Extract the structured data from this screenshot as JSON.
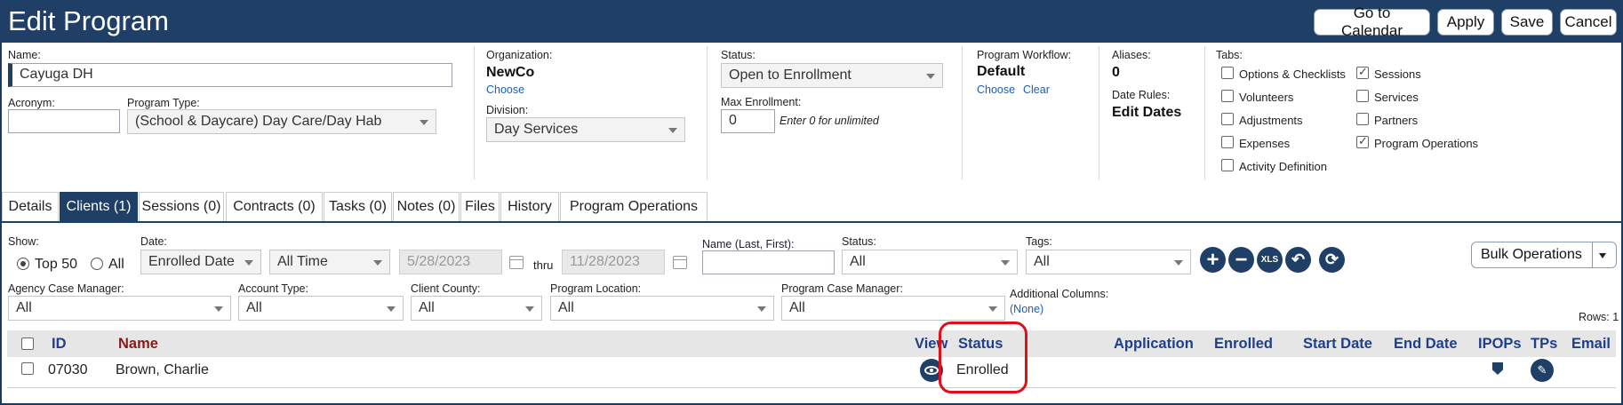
{
  "header": {
    "title": "Edit Program",
    "buttons": {
      "calendar": "Go to Calendar",
      "apply": "Apply",
      "save": "Save",
      "cancel": "Cancel"
    }
  },
  "form": {
    "name_label": "Name:",
    "name_value": "Cayuga DH",
    "acronym_label": "Acronym:",
    "acronym_value": "",
    "program_type_label": "Program Type:",
    "program_type_value": "(School & Daycare) Day Care/Day Hab",
    "organization_label": "Organization:",
    "organization_value": "NewCo",
    "organization_choose": "Choose",
    "division_label": "Division:",
    "division_value": "Day Services",
    "status_label": "Status:",
    "status_value": "Open to Enrollment",
    "max_enrollment_label": "Max Enrollment:",
    "max_enrollment_value": "0",
    "max_enrollment_hint": "Enter 0 for unlimited",
    "workflow_label": "Program Workflow:",
    "workflow_value": "Default",
    "workflow_choose": "Choose",
    "workflow_clear": "Clear",
    "aliases_label": "Aliases:",
    "aliases_value": "0",
    "date_rules_label": "Date Rules:",
    "date_rules_value": "Edit Dates",
    "tabs_label": "Tabs:",
    "tab_options": [
      {
        "label": "Options & Checklists",
        "checked": false
      },
      {
        "label": "Volunteers",
        "checked": false
      },
      {
        "label": "Adjustments",
        "checked": false
      },
      {
        "label": "Expenses",
        "checked": false
      },
      {
        "label": "Activity Definition",
        "checked": false
      },
      {
        "label": "Sessions",
        "checked": true
      },
      {
        "label": "Services",
        "checked": false
      },
      {
        "label": "Partners",
        "checked": false
      },
      {
        "label": "Program Operations",
        "checked": true
      }
    ]
  },
  "tabs": [
    {
      "label": "Details",
      "active": false
    },
    {
      "label": "Clients (1)",
      "active": true
    },
    {
      "label": "Sessions (0)",
      "active": false
    },
    {
      "label": "Contracts (0)",
      "active": false
    },
    {
      "label": "Tasks (0)",
      "active": false
    },
    {
      "label": "Notes (0)",
      "active": false
    },
    {
      "label": "Files",
      "active": false
    },
    {
      "label": "History",
      "active": false
    },
    {
      "label": "Program Operations",
      "active": false
    }
  ],
  "filters": {
    "show_label": "Show:",
    "top50": "Top 50",
    "all": "All",
    "date_label": "Date:",
    "date_field": "Enrolled Date",
    "date_range": "All Time",
    "from_date": "5/28/2023",
    "thru": "thru",
    "to_date": "11/28/2023",
    "name_label": "Name (Last, First):",
    "name_value": "",
    "status_label": "Status:",
    "status_value": "All",
    "tags_label": "Tags:",
    "tags_value": "All",
    "bulk_operations": "Bulk Operations",
    "agency_cm_label": "Agency Case Manager:",
    "agency_cm_value": "All",
    "account_type_label": "Account Type:",
    "account_type_value": "All",
    "client_county_label": "Client County:",
    "client_county_value": "All",
    "program_location_label": "Program Location:",
    "program_location_value": "All",
    "program_cm_label": "Program Case Manager:",
    "program_cm_value": "All",
    "additional_columns_label": "Additional Columns:",
    "additional_columns_value": "(None)",
    "rows_count": "Rows: 1",
    "xls": "XLS"
  },
  "table": {
    "headers": {
      "id": "ID",
      "name": "Name",
      "view": "View",
      "status": "Status",
      "application": "Application",
      "enrolled": "Enrolled",
      "start_date": "Start Date",
      "end_date": "End Date",
      "ipops": "IPOPs",
      "tps": "TPs",
      "email": "Email"
    },
    "rows": [
      {
        "id": "07030",
        "name": "Brown, Charlie",
        "status": "Enrolled"
      }
    ]
  },
  "colors": {
    "brand": "#1f3f66",
    "highlight": "#e0101a",
    "header_text": "#1f3f8a"
  }
}
